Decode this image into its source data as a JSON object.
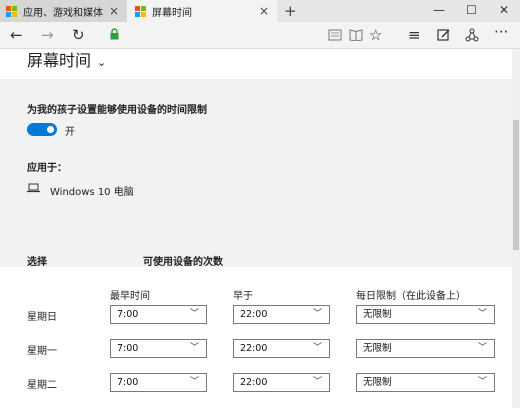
{
  "tabs": [
    {
      "label": "应用、游戏和媒体"
    },
    {
      "label": "屏幕时间"
    }
  ],
  "window": {
    "minimize": "—",
    "maximize": "☐",
    "close": "✕"
  },
  "header": {
    "title": "屏幕时间"
  },
  "limit_section": {
    "heading": "为我的孩子设置能够使用设备的时间限制",
    "toggle_state": "开",
    "applies_to_label": "应用于：",
    "device": "Windows 10 电脑"
  },
  "schedule": {
    "col_select": "选择",
    "col_times": "可使用设备的次数",
    "sub_earliest": "最早时间",
    "sub_before": "早于",
    "sub_daily": "每日限制（在此设备上）",
    "rows": [
      {
        "day": "星期日",
        "earliest": "7:00",
        "before": "22:00",
        "limit": "无限制"
      },
      {
        "day": "星期一",
        "earliest": "7:00",
        "before": "22:00",
        "limit": "无限制"
      },
      {
        "day": "星期二",
        "earliest": "7:00",
        "before": "22:00",
        "limit": "无限制"
      }
    ]
  },
  "icons": {
    "back": "back-arrow-icon",
    "forward": "forward-arrow-icon",
    "refresh": "refresh-icon",
    "lock": "lock-icon",
    "reading": "reading-view-icon",
    "favorite": "star-icon",
    "hub": "hub-icon",
    "note": "web-note-icon",
    "share": "share-icon",
    "more": "more-icon"
  },
  "colors": {
    "accent": "#0078d7",
    "panel": "#f2f2f2",
    "lock": "#2e9e3e"
  }
}
